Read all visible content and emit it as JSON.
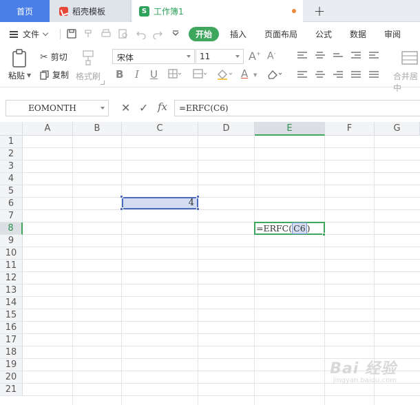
{
  "tabs": {
    "home": "首页",
    "template": "稻壳模板",
    "workbook": "工作簿1",
    "workbook_icon": "S"
  },
  "menu": {
    "file": "文件",
    "ribbon_tabs": [
      "开始",
      "插入",
      "页面布局",
      "公式",
      "数据",
      "审阅"
    ]
  },
  "ribbon": {
    "paste": "粘贴",
    "cut": "剪切",
    "copy": "复制",
    "format_painter": "格式刷",
    "font_name": "宋体",
    "font_size": "11",
    "merge_center": "合并居中"
  },
  "formula_bar": {
    "name_box": "EOMONTH",
    "fx": "fx",
    "formula": "=ERFC(C6)"
  },
  "sheet": {
    "columns": [
      "A",
      "B",
      "C",
      "D",
      "E",
      "F",
      "G"
    ],
    "rows": [
      "1",
      "2",
      "3",
      "4",
      "5",
      "6",
      "7",
      "8",
      "9",
      "10",
      "11",
      "12",
      "13",
      "14",
      "15",
      "16",
      "17",
      "18",
      "19",
      "20",
      "21"
    ],
    "c6_value": "4",
    "e8_prefix": "=ERFC(",
    "e8_ref": "C6",
    "e8_suffix": ")"
  },
  "watermark": {
    "text": "Bai 经验",
    "sub": "jingyan.baidu.com"
  }
}
